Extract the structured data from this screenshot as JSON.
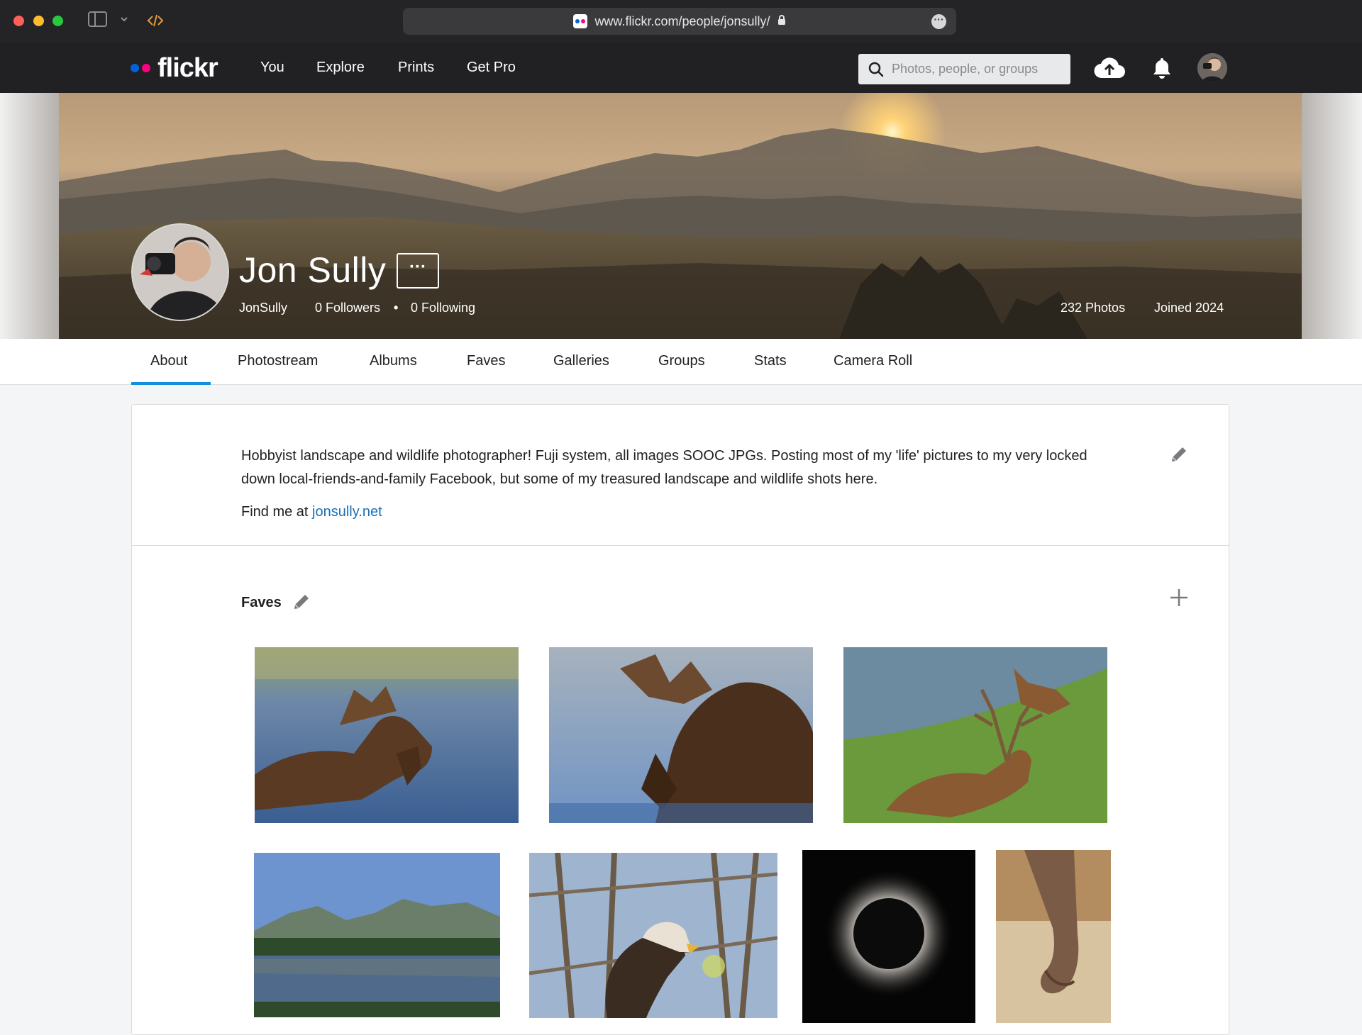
{
  "browser": {
    "url": "www.flickr.com/people/jonsully/"
  },
  "nav": {
    "links": [
      "You",
      "Explore",
      "Prints",
      "Get Pro"
    ],
    "search_placeholder": "Photos, people, or groups"
  },
  "profile": {
    "name": "Jon Sully",
    "username": "JonSully",
    "followers": "0 Followers",
    "following": "0 Following",
    "photos": "232 Photos",
    "joined": "Joined 2024"
  },
  "tabs": [
    "About",
    "Photostream",
    "Albums",
    "Faves",
    "Galleries",
    "Groups",
    "Stats",
    "Camera Roll"
  ],
  "about": {
    "bio": "Hobbyist landscape and wildlife photographer! Fuji system, all images SOOC JPGs. Posting most of my 'life' pictures to my very locked down local-friends-and-family Facebook, but some of my treasured landscape and wildlife shots here.",
    "find_prefix": "Find me at",
    "link_text": "jonsully.net"
  },
  "faves": {
    "title": "Faves"
  },
  "colors": {
    "accent": "#128fdc",
    "flickr_blue": "#0063dc",
    "flickr_pink": "#ff0084",
    "nav_bg": "#212124",
    "link": "#1a6fb5"
  }
}
